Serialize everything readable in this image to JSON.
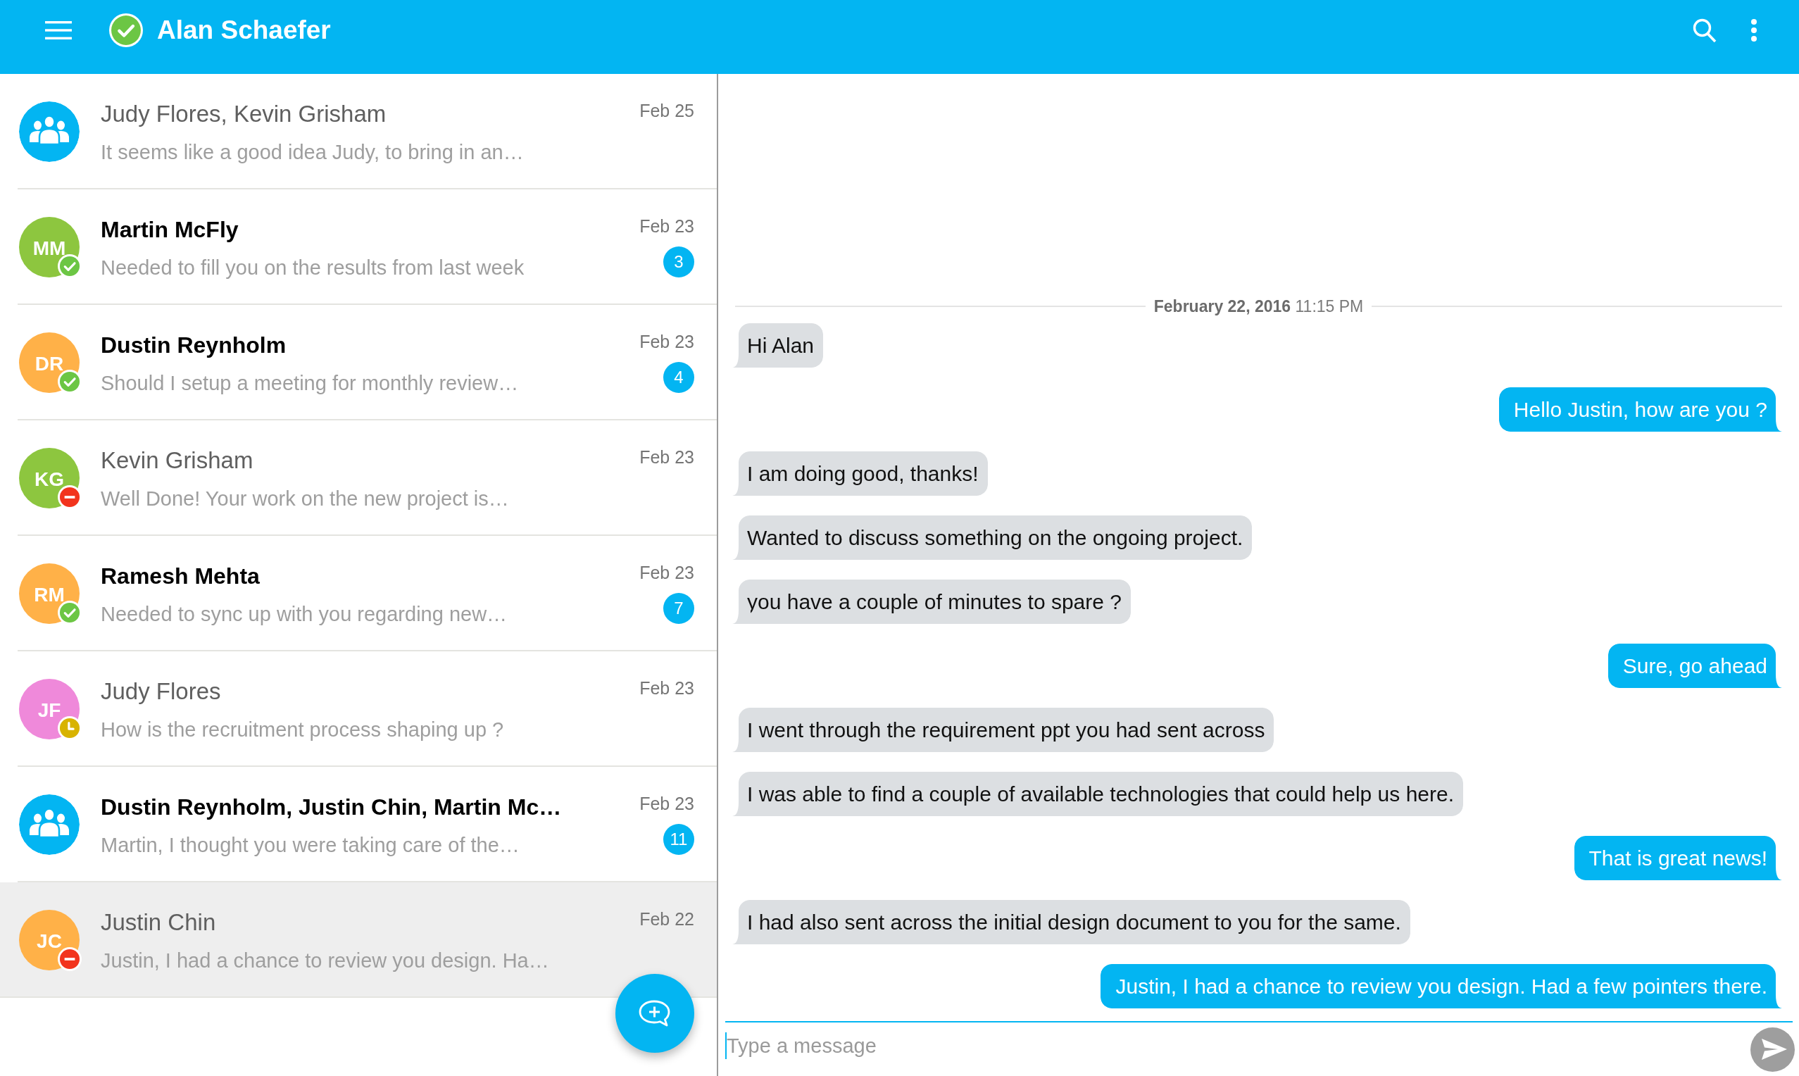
{
  "app_bar": {
    "title": "Alan Schaefer",
    "status": {
      "kind": "online"
    }
  },
  "conversations": [
    {
      "kind": "group",
      "color": "#03b5f2",
      "name": "Judy Flores, Kevin Grisham",
      "preview": "It seems like a good idea Judy, to bring in an…",
      "date": "Feb 25",
      "unread": false,
      "selected": false
    },
    {
      "kind": "person",
      "initials": "MM",
      "color": "#8dc63f",
      "status": {
        "kind": "online"
      },
      "name": "Martin McFly",
      "preview": "Needed to fill you on the results from last week",
      "date": "Feb 23",
      "unread": true,
      "badge": "3",
      "selected": false
    },
    {
      "kind": "person",
      "initials": "DR",
      "color": "#ffb148",
      "status": {
        "kind": "online"
      },
      "name": "Dustin Reynholm",
      "preview": "Should I setup a meeting for monthly review…",
      "date": "Feb 23",
      "unread": true,
      "badge": "4",
      "selected": false
    },
    {
      "kind": "person",
      "initials": "KG",
      "color": "#8dc63f",
      "status": {
        "kind": "busy"
      },
      "name": "Kevin Grisham",
      "preview": "Well Done! Your work on the new project is…",
      "date": "Feb 23",
      "unread": false,
      "selected": false
    },
    {
      "kind": "person",
      "initials": "RM",
      "color": "#ffb148",
      "status": {
        "kind": "online"
      },
      "name": "Ramesh Mehta",
      "preview": "Needed to sync up with you regarding new…",
      "date": "Feb 23",
      "unread": true,
      "badge": "7",
      "selected": false
    },
    {
      "kind": "person",
      "initials": "JF",
      "color": "#ef89da",
      "status": {
        "kind": "away"
      },
      "name": "Judy Flores",
      "preview": "How is the recruitment process shaping up ?",
      "date": "Feb 23",
      "unread": false,
      "selected": false
    },
    {
      "kind": "group",
      "color": "#03b5f2",
      "name": "Dustin Reynholm, Justin Chin, Martin Mc…",
      "preview": "Martin, I thought you were taking care of the…",
      "date": "Feb 23",
      "unread": true,
      "badge": "11",
      "selected": false
    },
    {
      "kind": "person",
      "initials": "JC",
      "color": "#ffb148",
      "status": {
        "kind": "busy"
      },
      "name": "Justin Chin",
      "preview": "Justin, I had a chance to review you design. Ha…",
      "date": "Feb 22",
      "unread": false,
      "selected": true
    }
  ],
  "chat": {
    "date_separator": "**February 22, 2016** 11:15 PM",
    "messages": [
      {
        "kind": "incoming",
        "text": "Hi Alan"
      },
      {
        "kind": "outgoing",
        "text": "Hello Justin, how are you ?"
      },
      {
        "kind": "incoming",
        "text": "I am doing good, thanks!"
      },
      {
        "kind": "incoming",
        "text": "Wanted to discuss something on the ongoing project."
      },
      {
        "kind": "incoming",
        "text": "you have a couple of minutes to spare ?"
      },
      {
        "kind": "outgoing",
        "text": "Sure, go ahead"
      },
      {
        "kind": "incoming",
        "text": "I went through the requirement ppt you had sent across"
      },
      {
        "kind": "incoming",
        "text": "I was able to find a couple of available technologies that could help us here."
      },
      {
        "kind": "outgoing",
        "text": "That is great news!"
      },
      {
        "kind": "incoming",
        "text": "I had also sent across the initial design document to you for the same."
      },
      {
        "kind": "outgoing",
        "text": "Justin, I had a chance to review you design. Had a few pointers there."
      }
    ]
  },
  "composer": {
    "placeholder": "Type a message"
  }
}
